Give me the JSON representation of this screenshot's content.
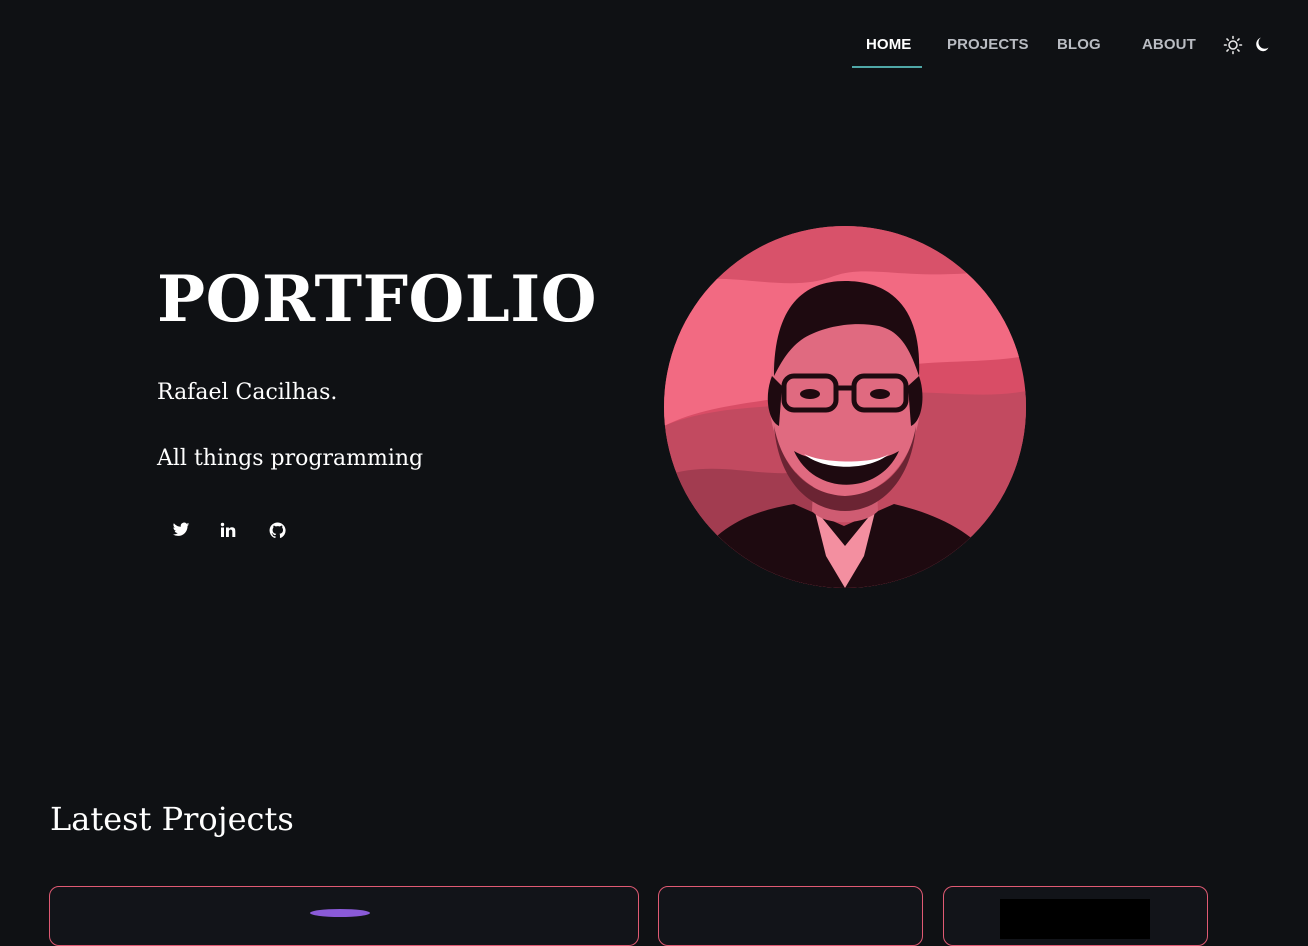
{
  "nav": {
    "items": [
      {
        "label": "HOME",
        "active": true
      },
      {
        "label": "PROJECTS",
        "active": false
      },
      {
        "label": "BLOG",
        "active": false
      },
      {
        "label": "ABOUT",
        "active": false
      }
    ],
    "theme_icons": [
      "sun-icon",
      "moon-icon"
    ]
  },
  "hero": {
    "title": "PORTFOLIO",
    "name": "Rafael Cacilhas.",
    "tagline": "All things programming",
    "socials": [
      "twitter-icon",
      "linkedin-icon",
      "github-icon"
    ]
  },
  "projects": {
    "title": "Latest Projects"
  },
  "colors": {
    "background": "#0f1114",
    "accent_underline": "#4fa7a7",
    "card_border": "#e05a73",
    "avatar_tint": "#e8667a"
  }
}
